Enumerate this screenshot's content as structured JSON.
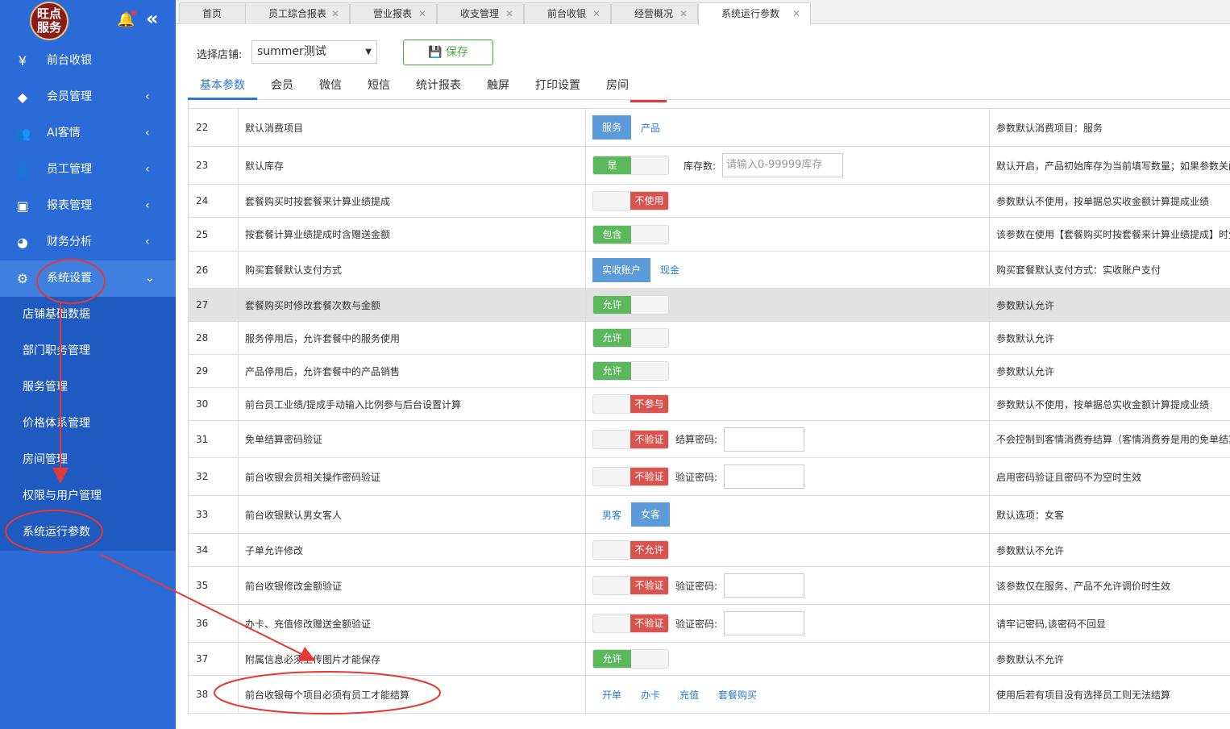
{
  "sidebar": {
    "logo": "旺点服务",
    "menu": [
      {
        "label": "前台收银",
        "icon": "yen-icon"
      },
      {
        "label": "会员管理",
        "icon": "diamond-icon"
      },
      {
        "label": "AI客情",
        "icon": "user-group-icon"
      },
      {
        "label": "员工管理",
        "icon": "user-icon"
      },
      {
        "label": "报表管理",
        "icon": "monitor-icon"
      },
      {
        "label": "财务分析",
        "icon": "pie-chart-icon"
      },
      {
        "label": "系统设置",
        "icon": "gear-icon"
      }
    ],
    "submenu": [
      "店铺基础数据",
      "部门职务管理",
      "服务管理",
      "价格体系管理",
      "房间管理",
      "权限与用户管理",
      "系统运行参数"
    ]
  },
  "tabs": [
    "首页",
    "员工综合报表",
    "营业报表",
    "收支管理",
    "前台收银",
    "经营概况",
    "系统运行参数"
  ],
  "filter": {
    "label": "选择店铺:",
    "store": "summer测试",
    "save": "保存"
  },
  "subtabs": [
    "基本参数",
    "会员",
    "微信",
    "短信",
    "统计报表",
    "触屏",
    "打印设置",
    "房间"
  ],
  "rows": [
    {
      "no": "22",
      "name": "默认消费项目",
      "opts": [
        "服务",
        "产品"
      ],
      "desc": "参数默认消费项目：服务"
    },
    {
      "no": "23",
      "name": "默认库存",
      "on": "是",
      "extra_label": "库存数:",
      "placeholder": "请输入0-99999库存",
      "desc": "默认开启，产品初始库存为当前填写数量；如果参数关闭"
    },
    {
      "no": "24",
      "name": "套餐购买时按套餐来计算业绩提成",
      "off": "不使用",
      "desc": "参数默认不使用，按单据总实收金额计算提成业绩"
    },
    {
      "no": "25",
      "name": "按套餐计算业绩提成时含赠送金额",
      "on": "包含",
      "desc": "该参数在使用【套餐购买时按套餐来计算业绩提成】时生效"
    },
    {
      "no": "26",
      "name": "购买套餐默认支付方式",
      "opts": [
        "实收账户",
        "现金"
      ],
      "desc": "购买套餐默认支付方式：实收账户支付"
    },
    {
      "no": "27",
      "name": "套餐购买时修改套餐次数与金额",
      "on": "允许",
      "desc": "参数默认允许"
    },
    {
      "no": "28",
      "name": "服务停用后，允许套餐中的服务使用",
      "on": "允许",
      "desc": "参数默认允许"
    },
    {
      "no": "29",
      "name": "产品停用后，允许套餐中的产品销售",
      "on": "允许",
      "desc": "参数默认允许"
    },
    {
      "no": "30",
      "name": "前台员工业绩/提成手动输入比例参与后台设置计算",
      "off": "不参与",
      "desc": "参数默认不使用，按单据总实收金额计算提成业绩"
    },
    {
      "no": "31",
      "name": "免单结算密码验证",
      "off": "不验证",
      "extra_label": "结算密码:",
      "desc": "不会控制到客情消费券结算（客情消费券是用的免单结算）"
    },
    {
      "no": "32",
      "name": "前台收银会员相关操作密码验证",
      "off": "不验证",
      "extra_label": "验证密码:",
      "desc": "启用密码验证且密码不为空时生效"
    },
    {
      "no": "33",
      "name": "前台收银默认男女客人",
      "opts": [
        "男客",
        "女客"
      ],
      "desc": "默认选项：女客"
    },
    {
      "no": "34",
      "name": "子单允许修改",
      "off": "不允许",
      "desc": "参数默认不允许"
    },
    {
      "no": "35",
      "name": "前台收银修改金额验证",
      "off": "不验证",
      "extra_label": "验证密码:",
      "desc": "该参数仅在服务、产品不允许调价时生效"
    },
    {
      "no": "36",
      "name": "办卡、充值修改赠送金额验证",
      "off": "不验证",
      "extra_label": "验证密码:",
      "desc": "请牢记密码,该密码不回显"
    },
    {
      "no": "37",
      "name": "附属信息必须上传图片才能保存",
      "on": "允许",
      "desc": "参数默认不允许"
    },
    {
      "no": "38",
      "name": "前台收银每个项目必须有员工才能结算",
      "links": [
        "开单",
        "办卡",
        "充值",
        "套餐购买"
      ],
      "desc": "使用后若有项目没有选择员工则无法结算"
    }
  ],
  "colors": {
    "sidebar": "#2a6bd8",
    "submenu": "#1f5ac0",
    "on": "#5cb85c",
    "off": "#d9534f",
    "annotation": "#e53935"
  }
}
